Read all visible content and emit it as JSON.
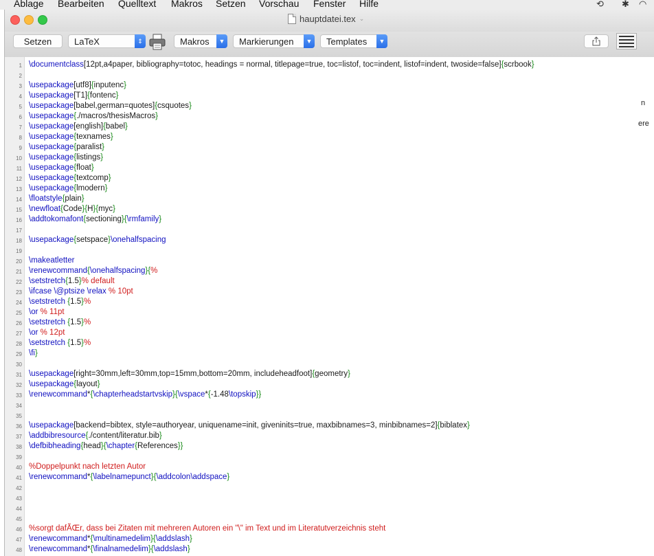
{
  "menubar": {
    "items": [
      "Ablage",
      "Bearbeiten",
      "Quelltext",
      "Makros",
      "Setzen",
      "Vorschau",
      "Fenster",
      "Hilfe"
    ],
    "icons": [
      "time-machine-icon",
      "bluetooth-icon",
      "wifi-icon"
    ]
  },
  "window": {
    "title": "hauptdatei.tex"
  },
  "toolbar": {
    "setzen_label": "Setzen",
    "typeset_mode": "LaTeX",
    "macros_label": "Makros",
    "markers_label": "Markierungen",
    "templates_label": "Templates"
  },
  "editor": {
    "lines": [
      {
        "n": "1",
        "text": "\\documentclass[12pt,a4paper, bibliography=totoc, headings = normal, titlepage=true, toc=listof, toc=indent, listof=indent, twoside=false]{scrbook}"
      },
      {
        "n": "2",
        "text": ""
      },
      {
        "n": "3",
        "text": "\\usepackage[utf8]{inputenc}"
      },
      {
        "n": "4",
        "text": "\\usepackage[T1]{fontenc}"
      },
      {
        "n": "5",
        "text": "\\usepackage[babel,german=quotes]{csquotes}"
      },
      {
        "n": "6",
        "text": "\\usepackage{./macros/thesisMacros}"
      },
      {
        "n": "7",
        "text": "\\usepackage[english]{babel}"
      },
      {
        "n": "8",
        "text": "\\usepackage{texnames}"
      },
      {
        "n": "9",
        "text": "\\usepackage{paralist}"
      },
      {
        "n": "10",
        "text": "\\usepackage{listings}"
      },
      {
        "n": "11",
        "text": "\\usepackage{float}"
      },
      {
        "n": "12",
        "text": "\\usepackage{textcomp}"
      },
      {
        "n": "13",
        "text": "\\usepackage{lmodern}"
      },
      {
        "n": "14",
        "text": "\\floatstyle{plain}"
      },
      {
        "n": "15",
        "text": "\\newfloat{Code}{H}{myc}"
      },
      {
        "n": "16",
        "text": "\\addtokomafont{sectioning}{\\rmfamily}"
      },
      {
        "n": "17",
        "text": ""
      },
      {
        "n": "18",
        "text": "\\usepackage{setspace}\\onehalfspacing"
      },
      {
        "n": "19",
        "text": ""
      },
      {
        "n": "20",
        "text": "\\makeatletter"
      },
      {
        "n": "21",
        "text": "\\renewcommand{\\onehalfspacing}{%"
      },
      {
        "n": "22",
        "text": "\\setstretch{1.5}% default"
      },
      {
        "n": "23",
        "text": "\\ifcase \\@ptsize \\relax % 10pt"
      },
      {
        "n": "24",
        "text": "\\setstretch {1.5}%"
      },
      {
        "n": "25",
        "text": "\\or % 11pt"
      },
      {
        "n": "26",
        "text": "\\setstretch {1.5}%"
      },
      {
        "n": "27",
        "text": "\\or % 12pt"
      },
      {
        "n": "28",
        "text": "\\setstretch {1.5}%"
      },
      {
        "n": "29",
        "text": "\\fi}"
      },
      {
        "n": "30",
        "text": ""
      },
      {
        "n": "31",
        "text": "\\usepackage[right=30mm,left=30mm,top=15mm,bottom=20mm, includeheadfoot]{geometry}"
      },
      {
        "n": "32",
        "text": "\\usepackage{layout}"
      },
      {
        "n": "33",
        "text": "\\renewcommand*{\\chapterheadstartvskip}{\\vspace*{-1.48\\topskip}}"
      },
      {
        "n": "34",
        "text": ""
      },
      {
        "n": "35",
        "text": ""
      },
      {
        "n": "36",
        "text": "\\usepackage[backend=bibtex, style=authoryear, uniquename=init, giveninits=true, maxbibnames=3, minbibnames=2]{biblatex}"
      },
      {
        "n": "37",
        "text": "\\addbibresource{./content/literatur.bib}"
      },
      {
        "n": "38",
        "text": "\\defbibheading{head}{\\chapter{References}}"
      },
      {
        "n": "39",
        "text": ""
      },
      {
        "n": "40",
        "text": "%Doppelpunkt nach letzten Autor"
      },
      {
        "n": "41",
        "text": "\\renewcommand*{\\labelnamepunct}{\\addcolon\\addspace}"
      },
      {
        "n": "42",
        "text": ""
      },
      {
        "n": "43",
        "text": ""
      },
      {
        "n": "44",
        "text": ""
      },
      {
        "n": "45",
        "text": ""
      },
      {
        "n": "46",
        "text": "%sorgt dafÃŒr, dass bei Zitaten mit mehreren Autoren ein \"\\\" im Text und im Literatutverzeichnis steht"
      },
      {
        "n": "47",
        "text": "\\renewcommand*{\\multinamedelim}{\\addslash}"
      },
      {
        "n": "48",
        "text": "\\renewcommand*{\\finalnamedelim}{\\addslash}"
      }
    ],
    "right_edge_fragments": [
      {
        "row": "5",
        "text": "n"
      },
      {
        "row": "7",
        "text": "ere"
      }
    ]
  },
  "colors": {
    "command": "#1010c0",
    "comment": "#d01c1c",
    "brace": "#1a8a1a",
    "accent": "#2a6fe8"
  }
}
